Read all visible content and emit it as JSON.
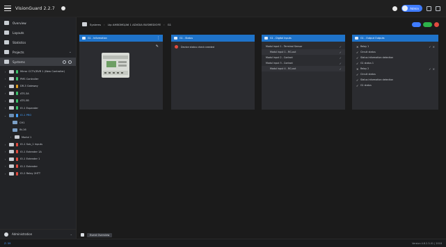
{
  "app": {
    "title": "VisionGuard 2.2.7"
  },
  "header": {
    "user": "Admin"
  },
  "sidebar": {
    "nav": [
      {
        "label": "Overview"
      },
      {
        "label": "Layouts"
      },
      {
        "label": "Statistics"
      },
      {
        "label": "Projects"
      },
      {
        "label": "Systems"
      }
    ],
    "tree": [
      {
        "label": "Mirror CCTV/DVR 1 (New Controller)",
        "status": "#3cc36b"
      },
      {
        "label": "PMS Controller",
        "status": "#3cc36b"
      },
      {
        "label": "DR-3 Gateway",
        "status": "#e0a020"
      },
      {
        "label": "ATS-3A",
        "status": "#3cc36b"
      },
      {
        "label": "ATS-5B",
        "status": "#3cc36b"
      },
      {
        "label": "IO-1 Expander",
        "status": "#3cc36b"
      },
      {
        "label": "IO-1 PRO",
        "status": "#43a0ff"
      },
      {
        "label": "CH1",
        "status": ""
      },
      {
        "label": "IN-16",
        "status": ""
      },
      {
        "label": "Modul 1",
        "status": ""
      },
      {
        "label": "IO-1 Sub_1 Inputs",
        "status": "#e24b3f"
      },
      {
        "label": "IO-1 Extender 1A",
        "status": "#e24b3f"
      },
      {
        "label": "IO-1 Extender 1",
        "status": "#e24b3f"
      },
      {
        "label": "IO-1 Extender",
        "status": "#e24b3f"
      },
      {
        "label": "IO-2 Relay 2HTT",
        "status": "#e24b3f"
      }
    ],
    "footer": "Administration"
  },
  "breadcrumb": [
    "Systems",
    "Ltp AHBGMG/A6 1 ADVDIA BUSMEDIOFE",
    "G1"
  ],
  "panels": {
    "general": {
      "title": "G1 - Information"
    },
    "status": {
      "title": "G1 - Status",
      "message": "Device status check needed"
    },
    "inputs": {
      "title": "G1 - Digital Inputs",
      "rows": [
        {
          "label": "Modul input 1 - Terminal Sensor",
          "indent": false
        },
        {
          "label": "Modul input 1 - RG-out",
          "indent": true
        },
        {
          "label": "Modul input 2 - Contact",
          "indent": false
        },
        {
          "label": "Modul input 3 - Contact",
          "indent": false
        },
        {
          "label": "Modul input 4 - RG-out",
          "indent": true
        }
      ]
    },
    "outputs": {
      "title": "G1 - Output Outputs",
      "rows": [
        {
          "label": "Relay 1",
          "check": "×",
          "toggle": true
        },
        {
          "label": "Circuit status",
          "check": "✓",
          "toggle": false
        },
        {
          "label": "Status information detection",
          "check": "✓",
          "toggle": false
        },
        {
          "label": "G1 status 1",
          "check": "✓",
          "toggle": false
        },
        {
          "label": "Relay 2",
          "check": "×",
          "toggle": true
        },
        {
          "label": "Circuit status",
          "check": "✓",
          "toggle": false
        },
        {
          "label": "Status information detection",
          "check": "✓",
          "toggle": false
        },
        {
          "label": "G1 status",
          "check": "✓",
          "toggle": false
        }
      ]
    }
  },
  "bottom": {
    "tab": "Event Overview"
  },
  "statusbar": {
    "left": "Z: 59",
    "right": "Version 4.8.2.3-01 | 2018"
  },
  "colors": {
    "accent": "#1f73c9",
    "pill_blue": "#3f7cff",
    "pill_green": "#2db34a",
    "pill_red": "#e24b3f"
  }
}
